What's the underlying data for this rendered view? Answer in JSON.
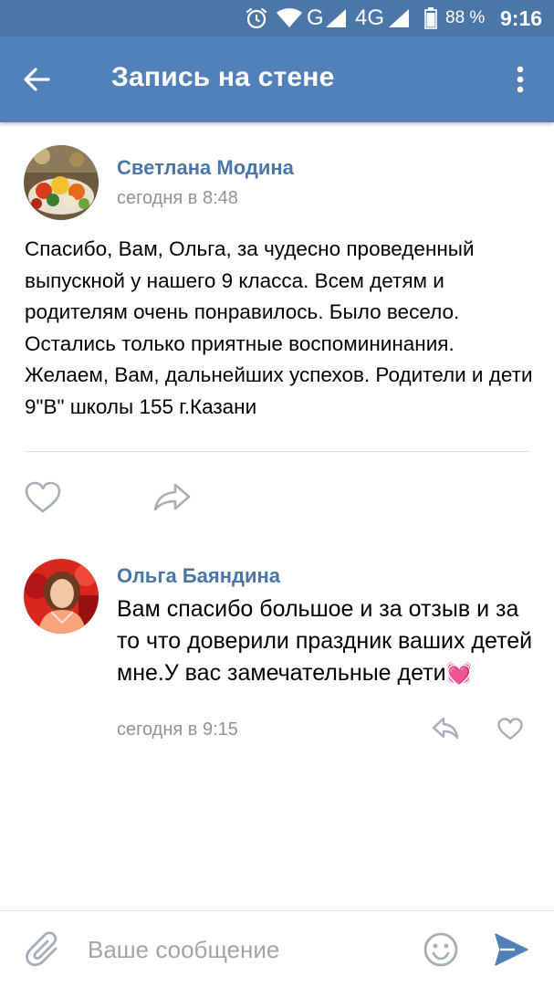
{
  "status_bar": {
    "network": "G",
    "network2": "4G",
    "battery": "88 %",
    "time": "9:16"
  },
  "header": {
    "title": "Запись на стене"
  },
  "post": {
    "author": "Светлана Модина",
    "time": "сегодня в 8:48",
    "text": "Спасибо, Вам, Ольга, за чудесно проведенный выпускной у нашего 9 класса. Всем детям и родителям очень понравилось. Было весело. Остались только приятные воспомининания. Желаем, Вам, дальнейших успехов. Родители и дети 9\"В\" школы 155 г.Казани"
  },
  "comment": {
    "author": "Ольга Баяндина",
    "text": "Вам спасибо большое и за отзыв и за то что доверили праздник ваших детей мне.У вас замечательные дети",
    "emoji": "💓",
    "time": "сегодня в 9:15"
  },
  "composer": {
    "placeholder": "Ваше сообщение"
  },
  "colors": {
    "header": "#5181b8",
    "status_bar": "#4a76a8",
    "link": "#4a76a8",
    "muted": "#939393",
    "send": "#5181b8"
  },
  "icons": [
    "alarm-icon",
    "wifi-icon",
    "signal-icon",
    "battery-icon",
    "back-arrow-icon",
    "more-vertical-icon",
    "heart-icon",
    "share-icon",
    "reply-icon",
    "attach-icon",
    "emoji-icon",
    "send-icon"
  ]
}
